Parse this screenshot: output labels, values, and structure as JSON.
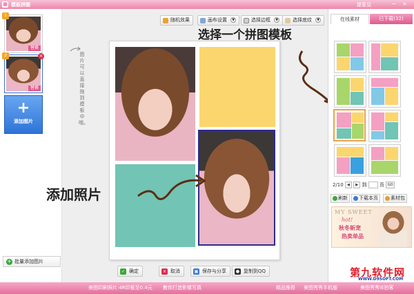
{
  "window": {
    "title": "模板拼图",
    "feedback": "提意见",
    "controls": [
      "−",
      "×"
    ]
  },
  "left_panel": {
    "thumbnails": [
      {
        "badge": "替换",
        "number": "1"
      },
      {
        "badge": "替换",
        "number": "2"
      }
    ],
    "add_photo": {
      "icon": "+",
      "label": "添加图片"
    },
    "batch_add": "批量添加图片"
  },
  "toolbar": {
    "random": "随机效果",
    "canvas_settings": "画布设置",
    "select_border": "选择边框",
    "select_texture": "选择底纹"
  },
  "canvas": {
    "side_note": "图片可以直接拖到模板中哦。",
    "colors": {
      "yellow": "#fbd66e",
      "teal": "#72c4b4",
      "selected_border": "#2c2c8e"
    }
  },
  "annotations": {
    "choose_template": "选择一个拼图模板",
    "add_photo": "添加照片"
  },
  "bottom_buttons": {
    "ok": "确定",
    "cancel": "取消",
    "save_share": "保存与分享",
    "copy_qq": "复制到QQ"
  },
  "right_panel": {
    "tab_online": "在线素材",
    "tab_downloaded": "已下载(32)",
    "pager": {
      "page": "2/10",
      "goto": "到",
      "unit": "页",
      "go": "GO"
    },
    "refresh": "刷新",
    "download_page": "下载本页",
    "material_pack": "素材包",
    "ad": {
      "line1": "MY SWEET",
      "line2": "hot!",
      "line3": "秋冬新宠",
      "line4": "热卖单品"
    }
  },
  "status_bar": {
    "item1": "美图印刷照片:4R印板至0.4元",
    "item2": "教你打造影楼写真",
    "item3": "精品推荐",
    "item4": "美图秀秀手机版",
    "item5": "美图秀秀IE拍客"
  },
  "watermark": {
    "main": "第九软件网",
    "url": "WWW.D9SOFT.COM"
  }
}
